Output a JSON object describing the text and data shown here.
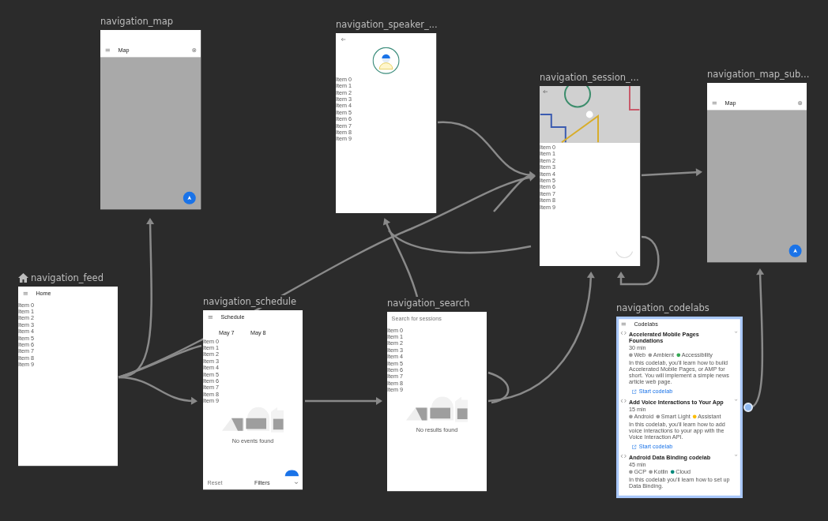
{
  "destinations": [
    {
      "kind": "map",
      "label": "navigation_map",
      "start": false,
      "selected": false,
      "toolbar_title": "Map"
    },
    {
      "kind": "profile",
      "label": "navigation_speaker_...",
      "start": false,
      "selected": false,
      "items": [
        "Item 0",
        "Item 1",
        "Item 2",
        "Item 3",
        "Item 4",
        "Item 5",
        "Item 6",
        "Item 7",
        "Item 8",
        "Item 9"
      ]
    },
    {
      "kind": "detail",
      "label": "navigation_session_...",
      "start": false,
      "selected": false,
      "items": [
        "Item 0",
        "Item 1",
        "Item 2",
        "Item 3",
        "Item 4",
        "Item 5",
        "Item 6",
        "Item 7",
        "Item 8",
        "Item 9"
      ]
    },
    {
      "kind": "map",
      "label": "navigation_map_sub...",
      "start": false,
      "selected": false,
      "toolbar_title": "Map"
    },
    {
      "kind": "list",
      "label": "navigation_feed",
      "start": true,
      "selected": false,
      "toolbar_title": "Home",
      "items": [
        "Item 0",
        "Item 1",
        "Item 2",
        "Item 3",
        "Item 4",
        "Item 5",
        "Item 6",
        "Item 7",
        "Item 8",
        "Item 9"
      ]
    },
    {
      "kind": "schedule",
      "label": "navigation_schedule",
      "start": false,
      "selected": false,
      "toolbar_title": "Schedule",
      "tabs": [
        "May 7",
        "May 8"
      ],
      "items": [
        "Item 0",
        "Item 1",
        "Item 2",
        "Item 3",
        "Item 4",
        "Item 5",
        "Item 6",
        "Item 7",
        "Item 8",
        "Item 9"
      ],
      "empty_text": "No events found",
      "reset": "Reset",
      "filters": "Filters"
    },
    {
      "kind": "search",
      "label": "navigation_search",
      "start": false,
      "selected": false,
      "placeholder": "Search for sessions",
      "items": [
        "Item 0",
        "Item 1",
        "Item 2",
        "Item 3",
        "Item 4",
        "Item 5",
        "Item 6",
        "Item 7",
        "Item 8",
        "Item 9"
      ],
      "empty_text": "No results found"
    },
    {
      "kind": "codelabs",
      "label": "navigation_codelabs",
      "start": false,
      "selected": true,
      "toolbar_title": "Codelabs",
      "cards": [
        {
          "title": "Accelerated Mobile Pages Foundations",
          "duration": "30 min",
          "tags": [
            {
              "text": "Web",
              "color": "#9e9e9e"
            },
            {
              "text": "Ambient",
              "color": "#9e9e9e"
            },
            {
              "text": "Accessibility",
              "color": "#34a853"
            }
          ],
          "description": "In this codelab, you'll learn how to build Accelerated Mobile Pages, or AMP for short. You will implement a simple news article web page.",
          "action": "Start codelab"
        },
        {
          "title": "Add Voice Interactions to Your App",
          "duration": "15 min",
          "tags": [
            {
              "text": "Android",
              "color": "#9e9e9e"
            },
            {
              "text": "Smart Light",
              "color": "#9e9e9e"
            },
            {
              "text": "Assistant",
              "color": "#fbbc04"
            }
          ],
          "description": "In this codelab, you'll learn how to add voice interactions to your app with the Voice Interaction API.",
          "action": "Start codelab"
        },
        {
          "title": "Android Data Binding codelab",
          "duration": "45 min",
          "tags": [
            {
              "text": "GCP",
              "color": "#9e9e9e"
            },
            {
              "text": "Kotlin",
              "color": "#9e9e9e"
            },
            {
              "text": "Cloud",
              "color": "#00897b"
            }
          ],
          "description": "In this codelab you'll learn how to set up Data Binding."
        }
      ]
    }
  ]
}
